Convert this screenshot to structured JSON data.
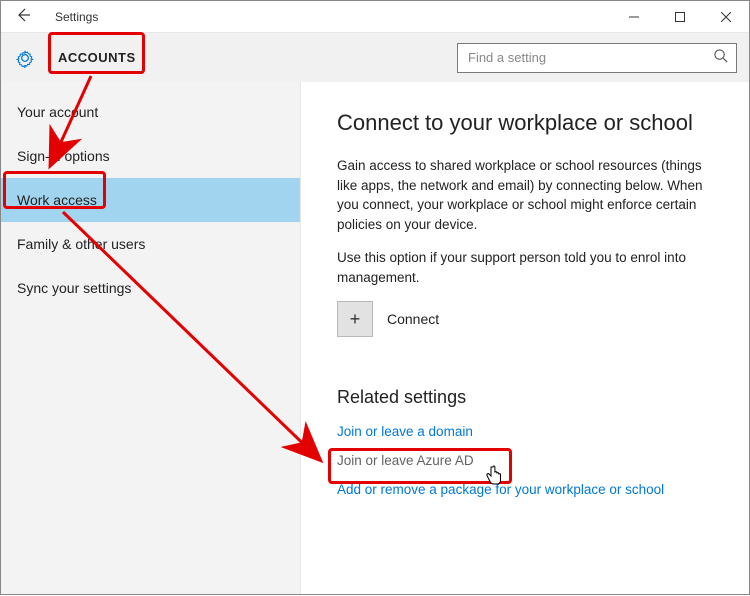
{
  "window": {
    "title": "Settings"
  },
  "breadcrumb": "ACCOUNTS",
  "search": {
    "placeholder": "Find a setting"
  },
  "sidebar": {
    "items": [
      {
        "label": "Your account"
      },
      {
        "label": "Sign-in options"
      },
      {
        "label": "Work access"
      },
      {
        "label": "Family & other users"
      },
      {
        "label": "Sync your settings"
      }
    ],
    "selected_index": 2
  },
  "main": {
    "heading": "Connect to your workplace or school",
    "para1": "Gain access to shared workplace or school resources (things like apps, the network and email) by connecting below. When you connect, your workplace or school might enforce certain policies on your device.",
    "para2": "Use this option if your support person told you to enrol into management.",
    "connect_label": "Connect",
    "related_heading": "Related settings",
    "link_domain": "Join or leave a domain",
    "link_azure": "Join or leave Azure AD",
    "link_package": "Add or remove a package for your workplace or school"
  }
}
